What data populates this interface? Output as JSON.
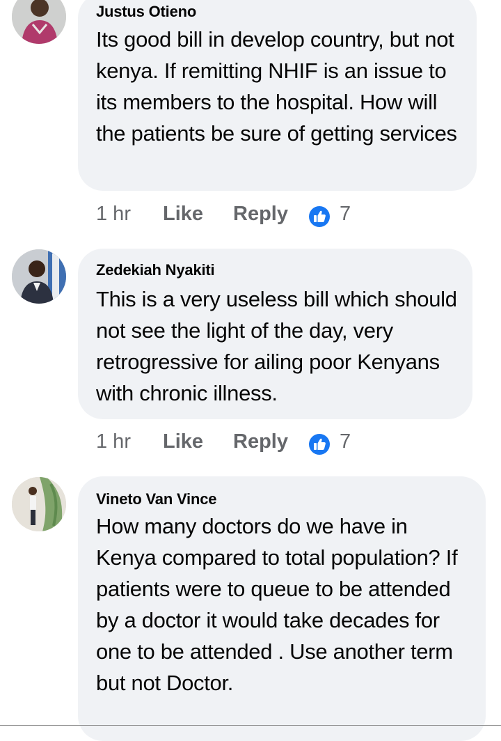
{
  "comments": [
    {
      "author": "Justus Otieno",
      "text": "Its good bill in develop country, but not kenya. If remitting NHIF is an issue to its members to the hospital. How will the patients be sure of getting services",
      "time": "1 hr",
      "like_label": "Like",
      "reply_label": "Reply",
      "reaction_count": "7",
      "reaction_icon": "thumbs-up-icon"
    },
    {
      "author": "Zedekiah Nyakiti",
      "text": "This is a very useless bill which should not see the light of the day, very retrogressive for ailing poor Kenyans with chronic illness.",
      "time": "1 hr",
      "like_label": "Like",
      "reply_label": "Reply",
      "reaction_count": "7",
      "reaction_icon": "thumbs-up-icon"
    },
    {
      "author": "Vineto Van Vince",
      "text": "How many doctors do we have in Kenya compared to total population? If patients were to queue to be attended by a doctor it would take decades for one to be attended . Use another term but not Doctor."
    }
  ],
  "colors": {
    "bubble": "#f0f2f5",
    "name": "#050505",
    "meta": "#65676b",
    "like_blue": "#1877f2"
  }
}
